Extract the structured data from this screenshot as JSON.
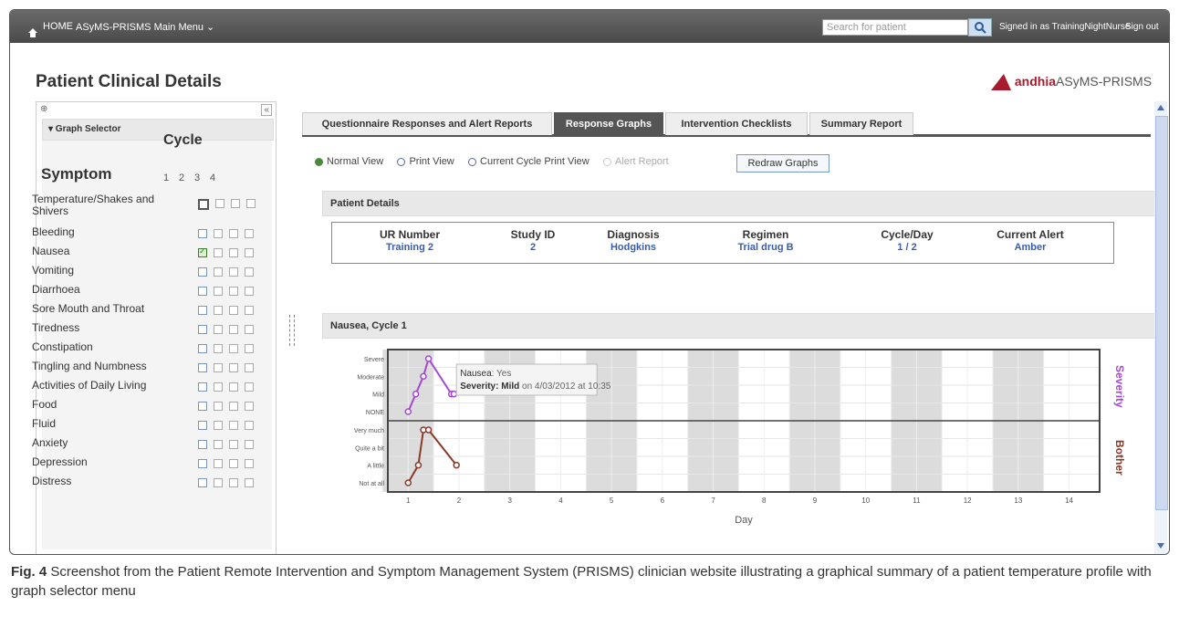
{
  "topbar": {
    "home": "HOME",
    "main_menu": "ASyMS-PRISMS Main Menu ⌄",
    "search_placeholder": "Search for patient",
    "signed_in": "Signed in as TrainingNightNurse",
    "sign_out": "Sign out"
  },
  "page_title": "Patient Clinical Details",
  "logo": {
    "brand_prefix": "andhia",
    "brand_suffix": "ASyMS-PRISMS"
  },
  "graph_selector": {
    "header": "▾  Graph Selector",
    "pin": "⊕",
    "collapse": "«",
    "cycle_label": "Cycle",
    "symptom_label": "Symptom",
    "cycles": [
      "1",
      "2",
      "3",
      "4"
    ],
    "symptoms": [
      {
        "label": "Temperature/Shakes and Shivers",
        "checked": [
          false,
          false,
          false,
          false
        ],
        "active": 0
      },
      {
        "label": "Bleeding",
        "checked": [
          false,
          false,
          false,
          false
        ]
      },
      {
        "label": "Nausea",
        "checked": [
          true,
          false,
          false,
          false
        ]
      },
      {
        "label": "Vomiting",
        "checked": [
          false,
          false,
          false,
          false
        ]
      },
      {
        "label": "Diarrhoea",
        "checked": [
          false,
          false,
          false,
          false
        ]
      },
      {
        "label": "Sore Mouth and Throat",
        "checked": [
          false,
          false,
          false,
          false
        ]
      },
      {
        "label": "Tiredness",
        "checked": [
          false,
          false,
          false,
          false
        ]
      },
      {
        "label": "Constipation",
        "checked": [
          false,
          false,
          false,
          false
        ]
      },
      {
        "label": "Tingling and Numbness",
        "checked": [
          false,
          false,
          false,
          false
        ]
      },
      {
        "label": "Activities of Daily Living",
        "checked": [
          false,
          false,
          false,
          false
        ]
      },
      {
        "label": "Food",
        "checked": [
          false,
          false,
          false,
          false
        ]
      },
      {
        "label": "Fluid",
        "checked": [
          false,
          false,
          false,
          false
        ]
      },
      {
        "label": "Anxiety",
        "checked": [
          false,
          false,
          false,
          false
        ]
      },
      {
        "label": "Depression",
        "checked": [
          false,
          false,
          false,
          false
        ]
      },
      {
        "label": "Distress",
        "checked": [
          false,
          false,
          false,
          false
        ]
      }
    ]
  },
  "tabs": [
    {
      "label": "Questionnaire Responses and Alert Reports",
      "active": false
    },
    {
      "label": "Response Graphs",
      "active": true
    },
    {
      "label": "Intervention Checklists",
      "active": false
    },
    {
      "label": "Summary Report",
      "active": false
    }
  ],
  "views": {
    "normal": "Normal View",
    "print": "Print View",
    "current_cycle": "Current Cycle Print View",
    "alert": "Alert Report",
    "redraw": "Redraw Graphs"
  },
  "patient_details": {
    "header": "Patient Details",
    "fields": [
      {
        "label": "UR Number",
        "value": "Training 2"
      },
      {
        "label": "Study ID",
        "value": "2"
      },
      {
        "label": "Diagnosis",
        "value": "Hodgkins"
      },
      {
        "label": "Regimen",
        "value": "Trial drug B"
      },
      {
        "label": "Cycle/Day",
        "value": "1 / 2"
      },
      {
        "label": "Current Alert",
        "value": "Amber"
      }
    ]
  },
  "graph": {
    "header": "Nausea, Cycle 1",
    "tooltip_line1_label": "Nausea",
    "tooltip_line1_value": ": Yes",
    "tooltip_line2_label": "Severity",
    "tooltip_line2_strong": ": Mild",
    "tooltip_line2_rest": " on 4/03/2012 at 10:35",
    "severity_label": "Severity",
    "bother_label": "Bother",
    "colors": {
      "severity": "#a44ad0",
      "bother": "#8b3a2a",
      "shade": "#dcdcdc"
    }
  },
  "chart_data": {
    "type": "line",
    "xlabel": "Day",
    "x_ticks": [
      "1",
      "2",
      "3",
      "4",
      "5",
      "6",
      "7",
      "8",
      "9",
      "10",
      "11",
      "12",
      "13",
      "14"
    ],
    "xlim": [
      0.6,
      14.6
    ],
    "shaded_days": [
      1,
      3,
      5,
      7,
      9,
      11,
      13
    ],
    "severity_levels": [
      "NONE",
      "Mild",
      "Moderate",
      "Severe"
    ],
    "bother_levels": [
      "Not at all",
      "A little",
      "Quite a bit",
      "Very much"
    ],
    "series": [
      {
        "name": "Severity",
        "x": [
          1.0,
          1.15,
          1.3,
          1.4,
          1.85,
          1.9
        ],
        "y": [
          0,
          1,
          2,
          3,
          1,
          1
        ]
      },
      {
        "name": "Bother",
        "x": [
          1.0,
          1.2,
          1.3,
          1.4,
          1.95
        ],
        "y": [
          0,
          1,
          3,
          3,
          1
        ]
      }
    ]
  },
  "caption": {
    "fig": "Fig. 4",
    "text": " Screenshot from the Patient Remote Intervention and Symptom Management System (PRISMS) clinician website illustrating a graphical summary of a patient temperature profile with graph selector menu"
  }
}
